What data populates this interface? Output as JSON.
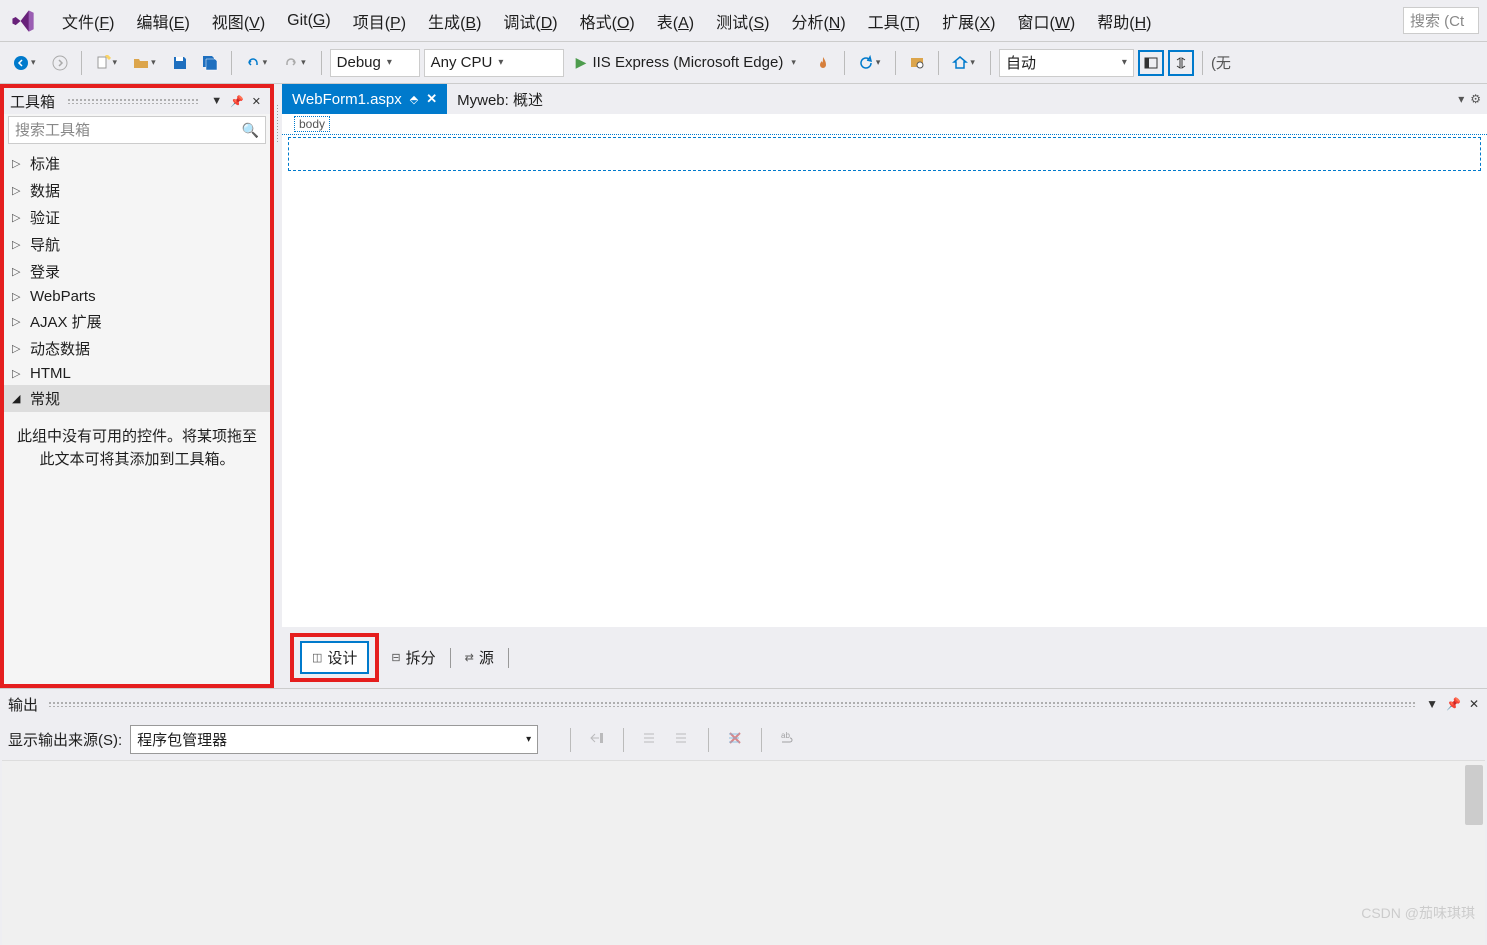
{
  "menu": {
    "items": [
      {
        "label": "文件",
        "key": "F"
      },
      {
        "label": "编辑",
        "key": "E"
      },
      {
        "label": "视图",
        "key": "V"
      },
      {
        "label": "Git",
        "key": "G"
      },
      {
        "label": "项目",
        "key": "P"
      },
      {
        "label": "生成",
        "key": "B"
      },
      {
        "label": "调试",
        "key": "D"
      },
      {
        "label": "格式",
        "key": "O"
      },
      {
        "label": "表",
        "key": "A"
      },
      {
        "label": "测试",
        "key": "S"
      },
      {
        "label": "分析",
        "key": "N"
      },
      {
        "label": "工具",
        "key": "T"
      },
      {
        "label": "扩展",
        "key": "X"
      },
      {
        "label": "窗口",
        "key": "W"
      },
      {
        "label": "帮助",
        "key": "H"
      }
    ],
    "search_placeholder": "搜索 (Ct"
  },
  "toolbar": {
    "config": "Debug",
    "platform": "Any CPU",
    "run_label": "IIS Express (Microsoft Edge)",
    "auto_label": "自动",
    "end_label": "(无"
  },
  "toolbox": {
    "title": "工具箱",
    "search_placeholder": "搜索工具箱",
    "categories": [
      {
        "label": "标准",
        "open": false
      },
      {
        "label": "数据",
        "open": false
      },
      {
        "label": "验证",
        "open": false
      },
      {
        "label": "导航",
        "open": false
      },
      {
        "label": "登录",
        "open": false
      },
      {
        "label": "WebParts",
        "open": false
      },
      {
        "label": "AJAX 扩展",
        "open": false
      },
      {
        "label": "动态数据",
        "open": false
      },
      {
        "label": "HTML",
        "open": false
      },
      {
        "label": "常规",
        "open": true
      }
    ],
    "empty_msg": "此组中没有可用的控件。将某项拖至此文本可将其添加到工具箱。"
  },
  "editor": {
    "tabs": [
      {
        "label": "WebForm1.aspx",
        "active": true
      },
      {
        "label": "Myweb: 概述",
        "active": false
      }
    ],
    "breadcrumb": "body"
  },
  "viewmode": {
    "design": "设计",
    "split": "拆分",
    "source": "源"
  },
  "output": {
    "title": "输出",
    "source_label": "显示输出来源(S):",
    "source_value": "程序包管理器"
  },
  "watermark": "CSDN @茄味琪琪"
}
